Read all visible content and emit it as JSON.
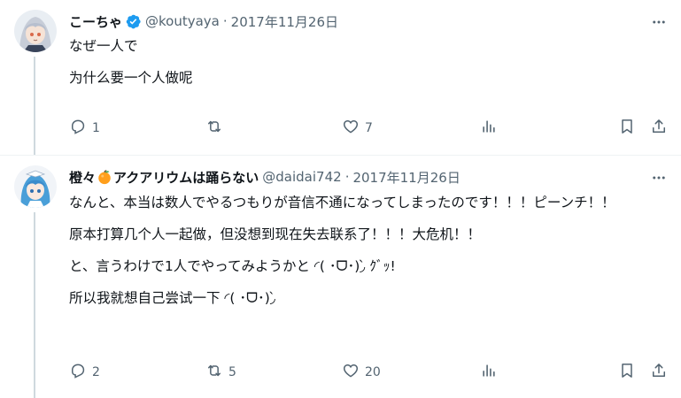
{
  "tweets": [
    {
      "display_name": "こーちゃ",
      "handle": "@koutyaya",
      "sep": "·",
      "date": "2017年11月26日",
      "verified": true,
      "paragraphs": [
        "なぜ一人で",
        "为什么要一个人做呢"
      ],
      "actions": {
        "reply_icon": "reply-icon",
        "reply_count": "1",
        "retweet_icon": "retweet-icon",
        "retweet_count": "",
        "like_icon": "heart-icon",
        "like_count": "7",
        "views_icon": "views-icon",
        "views_count": "",
        "bookmark_icon": "bookmark-icon",
        "share_icon": "share-icon"
      }
    },
    {
      "display_name_pre": "橙々",
      "display_name_post": "アクアリウムは踊らない",
      "name_emoji": "tangerine-emoji",
      "handle": "@daidai742",
      "sep": "·",
      "date": "2017年11月26日",
      "paragraphs": [
        "なんと、本当は数人でやるつもりが音信不通になってしまったのです！！！ピーンチ！！",
        "原本打算几个人一起做，但没想到现在失去联系了！！！大危机！！",
        "と、言うわけで1人でやってみようかと ◜( ･ᗜ･)◞̀ ｸﾞｯ!",
        "所以我就想自己尝试一下 ◜( ･ᗜ･)◞̀"
      ],
      "actions": {
        "reply_icon": "reply-icon",
        "reply_count": "2",
        "retweet_icon": "retweet-icon",
        "retweet_count": "5",
        "like_icon": "heart-icon",
        "like_count": "20",
        "views_icon": "views-icon",
        "views_count": "",
        "bookmark_icon": "bookmark-icon",
        "share_icon": "share-icon"
      }
    }
  ],
  "colors": {
    "text": "#0f1419",
    "secondary": "#536471",
    "verified": "#1d9bf0",
    "line": "#cfd9de",
    "divider": "#eff3f4"
  }
}
